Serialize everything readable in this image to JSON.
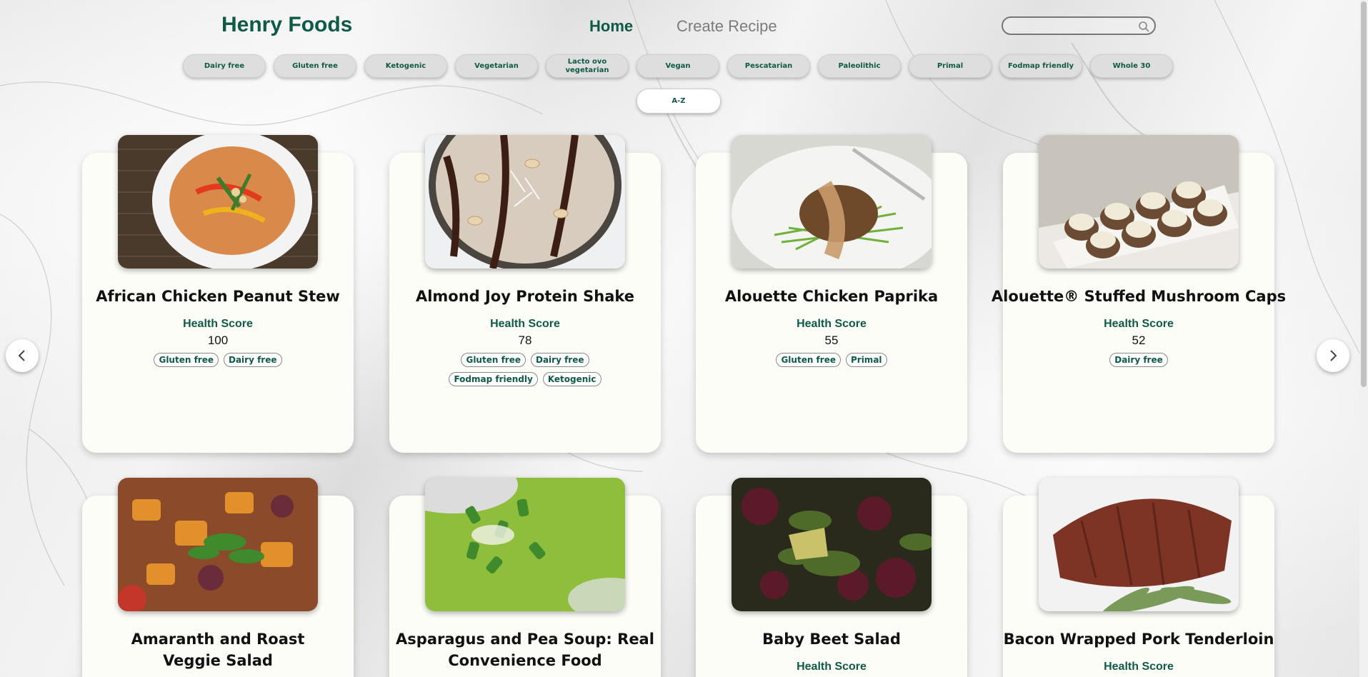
{
  "header": {
    "brand": "Henry Foods",
    "nav": {
      "home": "Home",
      "create": "Create Recipe"
    },
    "search": {
      "placeholder": "",
      "icon": "search-icon"
    }
  },
  "filters": [
    "Dairy free",
    "Gluten free",
    "Ketogenic",
    "Vegetarian",
    "Lacto ovo vegetarian",
    "Vegan",
    "Pescatarian",
    "Paleolithic",
    "Primal",
    "Fodmap friendly",
    "Whole 30"
  ],
  "sort": {
    "label": "A-Z"
  },
  "carousel": {
    "prev_icon": "chevron-left-icon",
    "next_icon": "chevron-right-icon"
  },
  "health_score_label": "Health Score",
  "recipes": [
    {
      "title": "African Chicken Peanut Stew",
      "score": "100",
      "tags": [
        "Gluten free",
        "Dairy free"
      ]
    },
    {
      "title": "Almond Joy Protein Shake",
      "score": "78",
      "tags": [
        "Gluten free",
        "Dairy free",
        "Fodmap friendly",
        "Ketogenic"
      ]
    },
    {
      "title": "Alouette Chicken Paprika",
      "score": "55",
      "tags": [
        "Gluten free",
        "Primal"
      ]
    },
    {
      "title": "Alouette® Stuffed Mushroom Caps",
      "score": "52",
      "tags": [
        "Dairy free"
      ]
    },
    {
      "title": "Amaranth and Roast Veggie Salad",
      "score": "",
      "tags": []
    },
    {
      "title": "Asparagus and Pea Soup: Real Convenience Food",
      "score": "",
      "tags": []
    },
    {
      "title": "Baby Beet Salad",
      "score": "",
      "tags": []
    },
    {
      "title": "Bacon Wrapped Pork Tenderloin",
      "score": "",
      "tags": []
    }
  ],
  "colors": {
    "brand": "#0e5a47",
    "card": "#fdfdf8",
    "pill": "#dedede"
  }
}
